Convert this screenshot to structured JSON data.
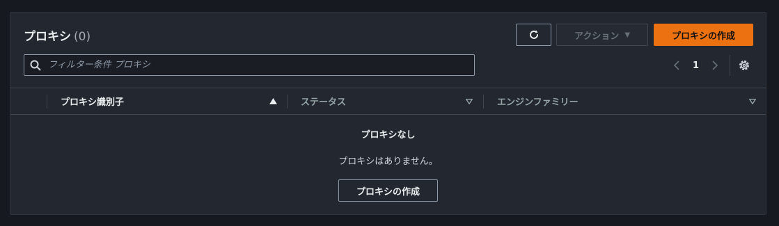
{
  "header": {
    "title": "プロキシ",
    "count": "(0)",
    "action_label": "アクション",
    "create_label": "プロキシの作成"
  },
  "search": {
    "placeholder": "フィルター条件 プロキシ",
    "value": ""
  },
  "pagination": {
    "current_page": "1"
  },
  "table": {
    "columns": [
      "プロキシ識別子",
      "ステータス",
      "エンジンファミリー"
    ],
    "sorted_column": "プロキシ識別子",
    "sort_direction": "ascending"
  },
  "empty_state": {
    "title": "プロキシなし",
    "description": "プロキシはありません。",
    "button_label": "プロキシの作成"
  },
  "colors": {
    "background": "#16191f",
    "panel": "#232730",
    "primary": "#ec7211",
    "border": "#8d99a8"
  }
}
